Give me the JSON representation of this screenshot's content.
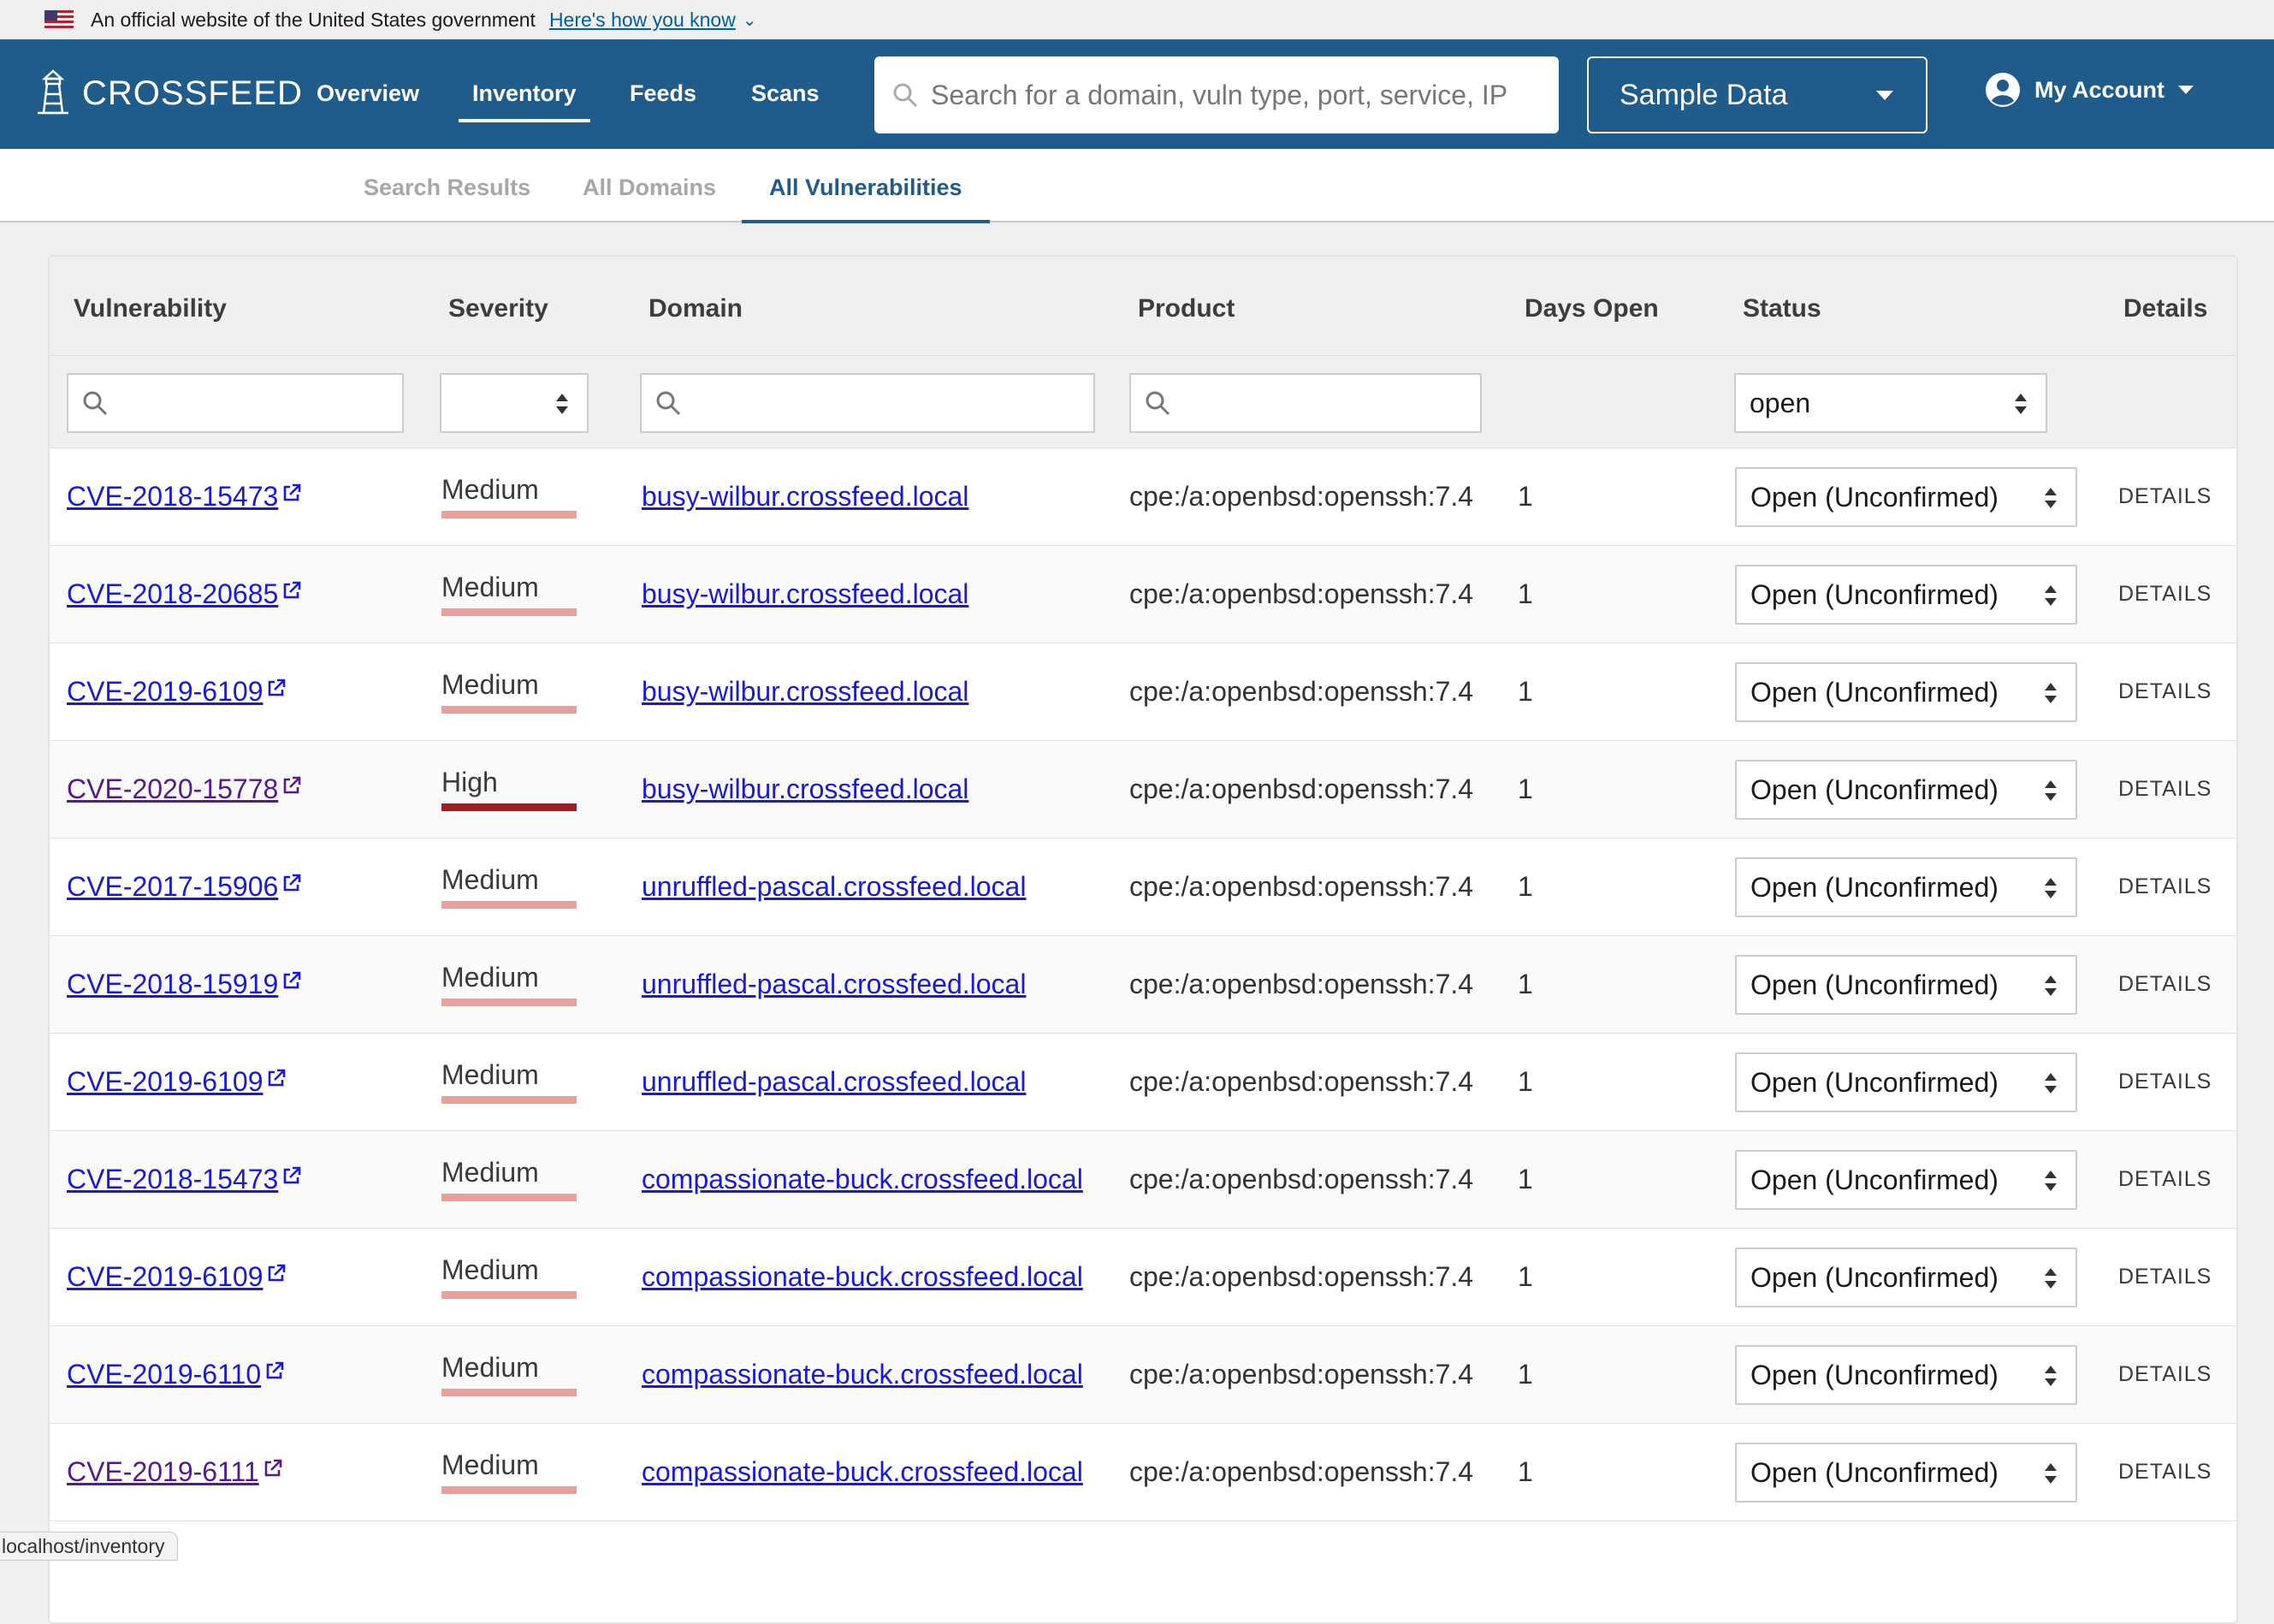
{
  "banner": {
    "text": "An official website of the United States government",
    "link": "Here's how you know"
  },
  "header": {
    "logo_text": "CROSSFEED",
    "nav": [
      "Overview",
      "Inventory",
      "Feeds",
      "Scans"
    ],
    "active_nav": "Inventory",
    "search_placeholder": "Search for a domain, vuln type, port, service, IP",
    "org_select": "Sample Data",
    "account_label": "My Account"
  },
  "subnav": {
    "tabs": [
      "Search Results",
      "All Domains",
      "All Vulnerabilities"
    ],
    "active_tab": "All Vulnerabilities"
  },
  "table": {
    "columns": [
      "Vulnerability",
      "Severity",
      "Domain",
      "Product",
      "Days Open",
      "Status",
      "Details"
    ],
    "status_filter": "open",
    "details_label": "DETAILS",
    "rows": [
      {
        "vuln": "CVE-2018-15473",
        "severity": "Medium",
        "domain": "busy-wilbur.crossfeed.local",
        "product": "cpe:/a:openbsd:openssh:7.4",
        "days": "1",
        "status": "Open (Unconfirmed)",
        "visited": false
      },
      {
        "vuln": "CVE-2018-20685",
        "severity": "Medium",
        "domain": "busy-wilbur.crossfeed.local",
        "product": "cpe:/a:openbsd:openssh:7.4",
        "days": "1",
        "status": "Open (Unconfirmed)",
        "visited": false
      },
      {
        "vuln": "CVE-2019-6109",
        "severity": "Medium",
        "domain": "busy-wilbur.crossfeed.local",
        "product": "cpe:/a:openbsd:openssh:7.4",
        "days": "1",
        "status": "Open (Unconfirmed)",
        "visited": false
      },
      {
        "vuln": "CVE-2020-15778",
        "severity": "High",
        "domain": "busy-wilbur.crossfeed.local",
        "product": "cpe:/a:openbsd:openssh:7.4",
        "days": "1",
        "status": "Open (Unconfirmed)",
        "visited": true
      },
      {
        "vuln": "CVE-2017-15906",
        "severity": "Medium",
        "domain": "unruffled-pascal.crossfeed.local",
        "product": "cpe:/a:openbsd:openssh:7.4",
        "days": "1",
        "status": "Open (Unconfirmed)",
        "visited": false
      },
      {
        "vuln": "CVE-2018-15919",
        "severity": "Medium",
        "domain": "unruffled-pascal.crossfeed.local",
        "product": "cpe:/a:openbsd:openssh:7.4",
        "days": "1",
        "status": "Open (Unconfirmed)",
        "visited": false
      },
      {
        "vuln": "CVE-2019-6109",
        "severity": "Medium",
        "domain": "unruffled-pascal.crossfeed.local",
        "product": "cpe:/a:openbsd:openssh:7.4",
        "days": "1",
        "status": "Open (Unconfirmed)",
        "visited": false
      },
      {
        "vuln": "CVE-2018-15473",
        "severity": "Medium",
        "domain": "compassionate-buck.crossfeed.local",
        "product": "cpe:/a:openbsd:openssh:7.4",
        "days": "1",
        "status": "Open (Unconfirmed)",
        "visited": false
      },
      {
        "vuln": "CVE-2019-6109",
        "severity": "Medium",
        "domain": "compassionate-buck.crossfeed.local",
        "product": "cpe:/a:openbsd:openssh:7.4",
        "days": "1",
        "status": "Open (Unconfirmed)",
        "visited": false
      },
      {
        "vuln": "CVE-2019-6110",
        "severity": "Medium",
        "domain": "compassionate-buck.crossfeed.local",
        "product": "cpe:/a:openbsd:openssh:7.4",
        "days": "1",
        "status": "Open (Unconfirmed)",
        "visited": false
      },
      {
        "vuln": "CVE-2019-6111",
        "severity": "Medium",
        "domain": "compassionate-buck.crossfeed.local",
        "product": "cpe:/a:openbsd:openssh:7.4",
        "days": "1",
        "status": "Open (Unconfirmed)",
        "visited": true
      }
    ]
  },
  "statusbar": {
    "url": "localhost/inventory"
  },
  "colors": {
    "header_bg": "#1f5c8b",
    "severity_medium": "#e9a09a",
    "severity_high": "#a61c1c",
    "link": "#1a1ad6",
    "link_visited": "#551a8b"
  }
}
